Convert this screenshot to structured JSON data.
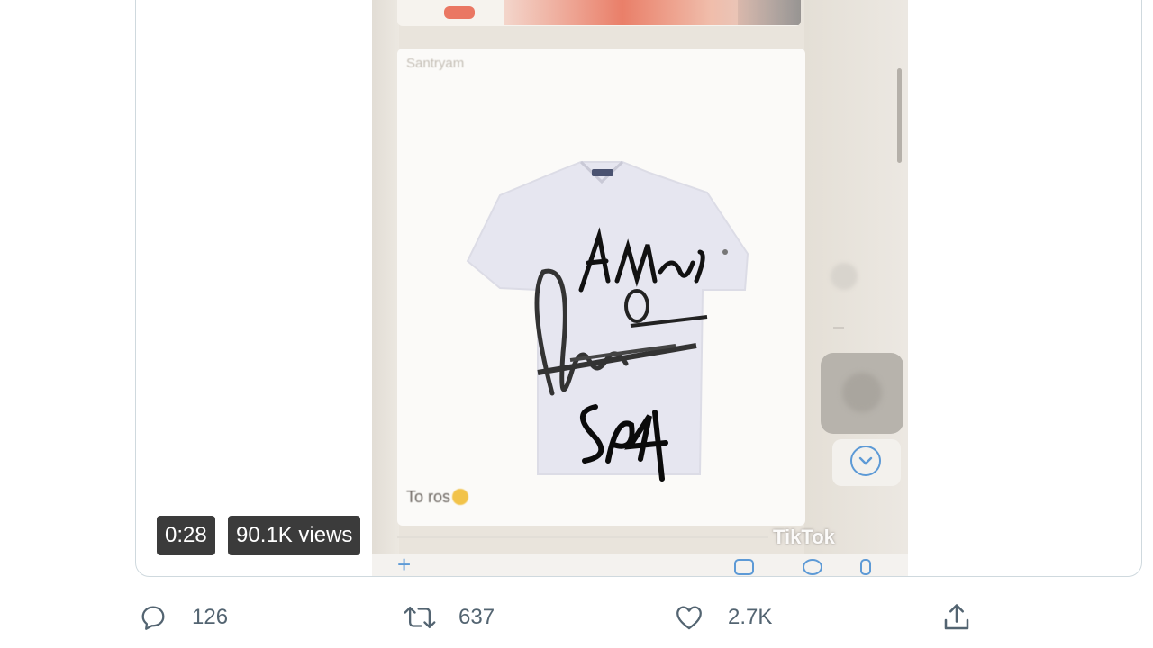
{
  "video": {
    "duration": "0:28",
    "views": "90.1K views",
    "frame": {
      "sender_name": "Santryam",
      "caption": "To ros",
      "caption_emoji": "grinning-emoji",
      "watermark": "TikTok",
      "shirt_signatures": [
        "Amar",
        "Irina",
        "SA4"
      ]
    }
  },
  "actions": {
    "reply": {
      "icon": "reply-icon",
      "count": "126"
    },
    "retweet": {
      "icon": "retweet-icon",
      "count": "637"
    },
    "like": {
      "icon": "heart-icon",
      "count": "2.7K"
    },
    "share": {
      "icon": "share-icon"
    }
  },
  "colors": {
    "action_gray": "#536471",
    "card_border": "#cfd9de",
    "badge_bg": "rgba(0,0,0,0.77)",
    "chat_accent": "#5d9ad6"
  }
}
